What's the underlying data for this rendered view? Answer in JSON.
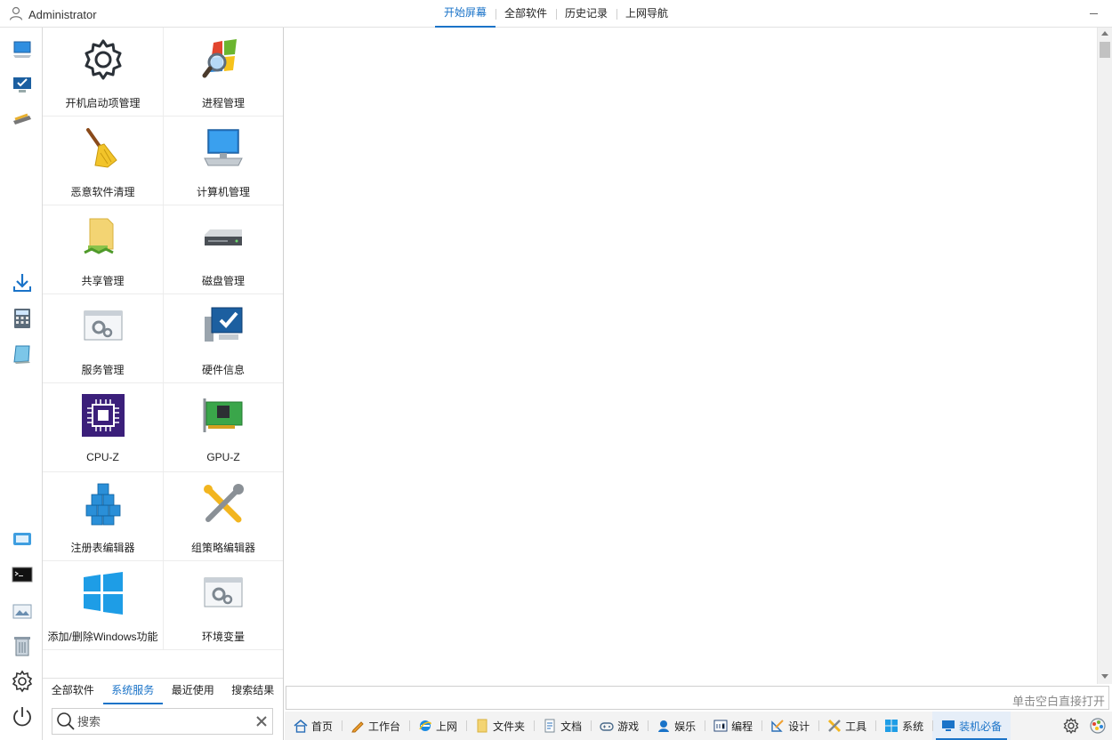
{
  "header": {
    "user_name": "Administrator",
    "tabs": [
      {
        "label": "开始屏幕",
        "active": true
      },
      {
        "label": "全部软件",
        "active": false
      },
      {
        "label": "历史记录",
        "active": false
      },
      {
        "label": "上网导航",
        "active": false
      }
    ]
  },
  "sidebar": {
    "icons": [
      "computer-icon",
      "monitor-check-icon",
      "scanner-icon",
      "download-icon",
      "calculator-icon",
      "notebook-icon",
      "remote-window-icon",
      "terminal-icon",
      "image-viewer-icon",
      "recycle-bin-icon",
      "settings-icon",
      "power-icon"
    ]
  },
  "apps": [
    {
      "label": "开机启动项管理",
      "icon": "gear-icon"
    },
    {
      "label": "进程管理",
      "icon": "windows-search-icon"
    },
    {
      "label": "恶意软件清理",
      "icon": "broom-icon"
    },
    {
      "label": "计算机管理",
      "icon": "desktop-computer-icon"
    },
    {
      "label": "共享管理",
      "icon": "shared-folder-icon"
    },
    {
      "label": "磁盘管理",
      "icon": "disk-drive-icon"
    },
    {
      "label": "服务管理",
      "icon": "services-window-icon"
    },
    {
      "label": "硬件信息",
      "icon": "hardware-monitor-icon"
    },
    {
      "label": "CPU-Z",
      "icon": "cpu-chip-icon"
    },
    {
      "label": "GPU-Z",
      "icon": "graphics-card-icon"
    },
    {
      "label": "注册表编辑器",
      "icon": "registry-cubes-icon"
    },
    {
      "label": "组策略编辑器",
      "icon": "tools-wrench-icon"
    },
    {
      "label": "添加/删除Windows功能",
      "icon": "windows-logo-icon"
    },
    {
      "label": "环境变量",
      "icon": "settings-window-icon"
    }
  ],
  "panel_tabs": [
    {
      "label": "全部软件",
      "active": false
    },
    {
      "label": "系统服务",
      "active": true
    },
    {
      "label": "最近使用",
      "active": false
    },
    {
      "label": "搜索结果",
      "active": false
    }
  ],
  "search": {
    "placeholder": "搜索"
  },
  "hint": "单击空白直接打开",
  "categories": [
    {
      "label": "首页",
      "icon": "home-icon",
      "active": false
    },
    {
      "label": "工作台",
      "icon": "pencil-icon",
      "active": false
    },
    {
      "label": "上网",
      "icon": "browser-icon",
      "active": false
    },
    {
      "label": "文件夹",
      "icon": "folder-icon",
      "active": false
    },
    {
      "label": "文档",
      "icon": "document-icon",
      "active": false
    },
    {
      "label": "游戏",
      "icon": "gamepad-icon",
      "active": false
    },
    {
      "label": "娱乐",
      "icon": "entertainment-icon",
      "active": false
    },
    {
      "label": "编程",
      "icon": "code-icon",
      "active": false
    },
    {
      "label": "设计",
      "icon": "design-icon",
      "active": false
    },
    {
      "label": "工具",
      "icon": "tools-icon",
      "active": false
    },
    {
      "label": "系统",
      "icon": "windows-icon",
      "active": false
    },
    {
      "label": "装机必备",
      "icon": "monitor-icon",
      "active": true
    }
  ],
  "colors": {
    "accent": "#1a73c8"
  }
}
